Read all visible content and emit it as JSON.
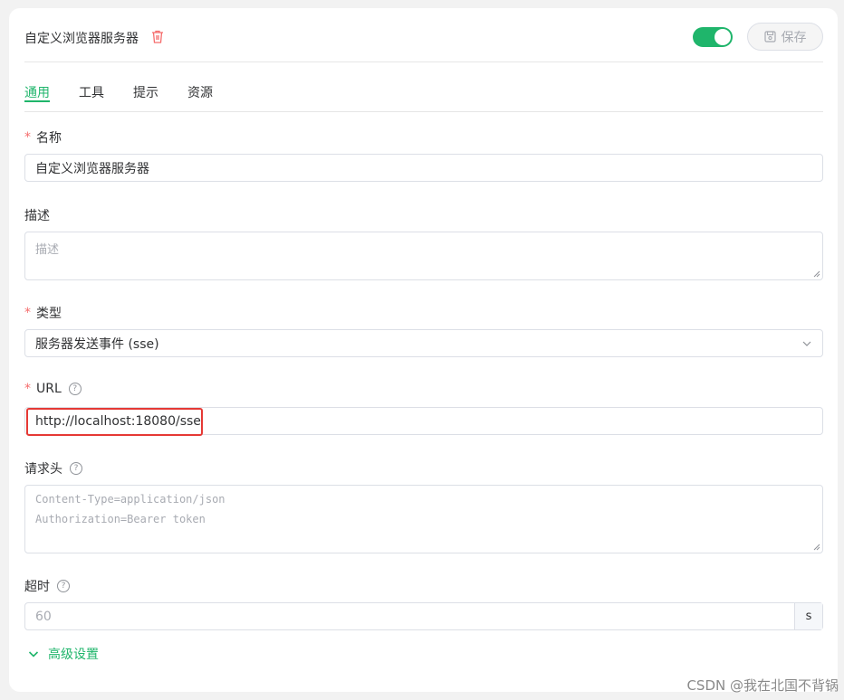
{
  "header": {
    "title": "自定义浏览器服务器",
    "trash_icon": "trash-icon",
    "toggle_enabled": true,
    "save_label": "保存",
    "save_icon": "save-icon"
  },
  "tabs": [
    {
      "label": "通用",
      "active": true
    },
    {
      "label": "工具",
      "active": false
    },
    {
      "label": "提示",
      "active": false
    },
    {
      "label": "资源",
      "active": false
    }
  ],
  "form": {
    "name": {
      "label": "名称",
      "required": "*",
      "value": "自定义浏览器服务器"
    },
    "description": {
      "label": "描述",
      "placeholder": "描述"
    },
    "type": {
      "label": "类型",
      "required": "*",
      "value": "服务器发送事件 (sse)"
    },
    "url": {
      "label": "URL",
      "required": "*",
      "value": "http://localhost:18080/sse",
      "help": "?"
    },
    "headers": {
      "label": "请求头",
      "help": "?",
      "placeholder_line1": "Content-Type=application/json",
      "placeholder_line2": "Authorization=Bearer token"
    },
    "timeout": {
      "label": "超时",
      "help": "?",
      "placeholder": "60",
      "suffix": "s"
    }
  },
  "advanced": {
    "label": "高级设置",
    "icon": "chevron-down-icon"
  },
  "watermark": "CSDN @我在北国不背锅",
  "colors": {
    "accent": "#1fb56b",
    "required": "#f56c6c",
    "highlight": "#e53935"
  }
}
